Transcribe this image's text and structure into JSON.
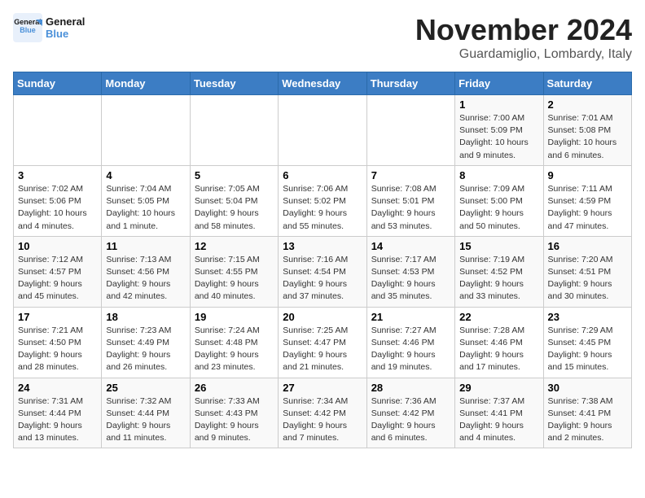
{
  "logo": {
    "line1": "General",
    "line2": "Blue"
  },
  "title": "November 2024",
  "subtitle": "Guardamiglio, Lombardy, Italy",
  "weekdays": [
    "Sunday",
    "Monday",
    "Tuesday",
    "Wednesday",
    "Thursday",
    "Friday",
    "Saturday"
  ],
  "weeks": [
    [
      {
        "day": "",
        "info": ""
      },
      {
        "day": "",
        "info": ""
      },
      {
        "day": "",
        "info": ""
      },
      {
        "day": "",
        "info": ""
      },
      {
        "day": "",
        "info": ""
      },
      {
        "day": "1",
        "info": "Sunrise: 7:00 AM\nSunset: 5:09 PM\nDaylight: 10 hours and 9 minutes."
      },
      {
        "day": "2",
        "info": "Sunrise: 7:01 AM\nSunset: 5:08 PM\nDaylight: 10 hours and 6 minutes."
      }
    ],
    [
      {
        "day": "3",
        "info": "Sunrise: 7:02 AM\nSunset: 5:06 PM\nDaylight: 10 hours and 4 minutes."
      },
      {
        "day": "4",
        "info": "Sunrise: 7:04 AM\nSunset: 5:05 PM\nDaylight: 10 hours and 1 minute."
      },
      {
        "day": "5",
        "info": "Sunrise: 7:05 AM\nSunset: 5:04 PM\nDaylight: 9 hours and 58 minutes."
      },
      {
        "day": "6",
        "info": "Sunrise: 7:06 AM\nSunset: 5:02 PM\nDaylight: 9 hours and 55 minutes."
      },
      {
        "day": "7",
        "info": "Sunrise: 7:08 AM\nSunset: 5:01 PM\nDaylight: 9 hours and 53 minutes."
      },
      {
        "day": "8",
        "info": "Sunrise: 7:09 AM\nSunset: 5:00 PM\nDaylight: 9 hours and 50 minutes."
      },
      {
        "day": "9",
        "info": "Sunrise: 7:11 AM\nSunset: 4:59 PM\nDaylight: 9 hours and 47 minutes."
      }
    ],
    [
      {
        "day": "10",
        "info": "Sunrise: 7:12 AM\nSunset: 4:57 PM\nDaylight: 9 hours and 45 minutes."
      },
      {
        "day": "11",
        "info": "Sunrise: 7:13 AM\nSunset: 4:56 PM\nDaylight: 9 hours and 42 minutes."
      },
      {
        "day": "12",
        "info": "Sunrise: 7:15 AM\nSunset: 4:55 PM\nDaylight: 9 hours and 40 minutes."
      },
      {
        "day": "13",
        "info": "Sunrise: 7:16 AM\nSunset: 4:54 PM\nDaylight: 9 hours and 37 minutes."
      },
      {
        "day": "14",
        "info": "Sunrise: 7:17 AM\nSunset: 4:53 PM\nDaylight: 9 hours and 35 minutes."
      },
      {
        "day": "15",
        "info": "Sunrise: 7:19 AM\nSunset: 4:52 PM\nDaylight: 9 hours and 33 minutes."
      },
      {
        "day": "16",
        "info": "Sunrise: 7:20 AM\nSunset: 4:51 PM\nDaylight: 9 hours and 30 minutes."
      }
    ],
    [
      {
        "day": "17",
        "info": "Sunrise: 7:21 AM\nSunset: 4:50 PM\nDaylight: 9 hours and 28 minutes."
      },
      {
        "day": "18",
        "info": "Sunrise: 7:23 AM\nSunset: 4:49 PM\nDaylight: 9 hours and 26 minutes."
      },
      {
        "day": "19",
        "info": "Sunrise: 7:24 AM\nSunset: 4:48 PM\nDaylight: 9 hours and 23 minutes."
      },
      {
        "day": "20",
        "info": "Sunrise: 7:25 AM\nSunset: 4:47 PM\nDaylight: 9 hours and 21 minutes."
      },
      {
        "day": "21",
        "info": "Sunrise: 7:27 AM\nSunset: 4:46 PM\nDaylight: 9 hours and 19 minutes."
      },
      {
        "day": "22",
        "info": "Sunrise: 7:28 AM\nSunset: 4:46 PM\nDaylight: 9 hours and 17 minutes."
      },
      {
        "day": "23",
        "info": "Sunrise: 7:29 AM\nSunset: 4:45 PM\nDaylight: 9 hours and 15 minutes."
      }
    ],
    [
      {
        "day": "24",
        "info": "Sunrise: 7:31 AM\nSunset: 4:44 PM\nDaylight: 9 hours and 13 minutes."
      },
      {
        "day": "25",
        "info": "Sunrise: 7:32 AM\nSunset: 4:44 PM\nDaylight: 9 hours and 11 minutes."
      },
      {
        "day": "26",
        "info": "Sunrise: 7:33 AM\nSunset: 4:43 PM\nDaylight: 9 hours and 9 minutes."
      },
      {
        "day": "27",
        "info": "Sunrise: 7:34 AM\nSunset: 4:42 PM\nDaylight: 9 hours and 7 minutes."
      },
      {
        "day": "28",
        "info": "Sunrise: 7:36 AM\nSunset: 4:42 PM\nDaylight: 9 hours and 6 minutes."
      },
      {
        "day": "29",
        "info": "Sunrise: 7:37 AM\nSunset: 4:41 PM\nDaylight: 9 hours and 4 minutes."
      },
      {
        "day": "30",
        "info": "Sunrise: 7:38 AM\nSunset: 4:41 PM\nDaylight: 9 hours and 2 minutes."
      }
    ]
  ]
}
